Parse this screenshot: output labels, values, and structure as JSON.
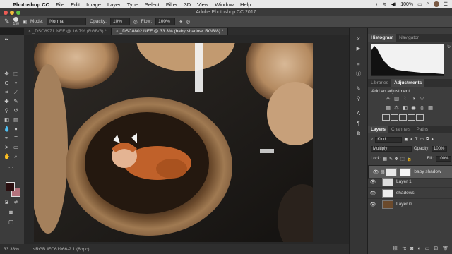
{
  "menubar": {
    "apple": "",
    "app": "Photoshop CC",
    "items": [
      "File",
      "Edit",
      "Image",
      "Layer",
      "Type",
      "Select",
      "Filter",
      "3D",
      "View",
      "Window",
      "Help"
    ],
    "battery": "100%",
    "clock": ""
  },
  "window": {
    "title": "Adobe Photoshop CC 2017"
  },
  "options": {
    "brush_size": "150",
    "mode_label": "Mode:",
    "mode_value": "Normal",
    "opacity_label": "Opacity:",
    "opacity_value": "10%",
    "flow_label": "Flow:",
    "flow_value": "100%"
  },
  "tabs": [
    {
      "label": "_DSC8971.NEF @ 16.7% (RGB/8) *"
    },
    {
      "label": "_DSC8802.NEF @ 33.3% (baby shadow, RGB/8) *"
    }
  ],
  "status": {
    "zoom": "33.33%",
    "profile": "sRGB IEC61966-2.1 (8bpc)"
  },
  "panels": {
    "histogram_tabs": [
      "Histogram",
      "Navigator"
    ],
    "adjust_tabs": [
      "Libraries",
      "Adjustments"
    ],
    "add_adjustment": "Add an adjustment",
    "layers_tabs": [
      "Layers",
      "Channels",
      "Paths"
    ],
    "kind": "Kind",
    "blend_mode": "Multiply",
    "opacity_label": "Opacity:",
    "opacity_value": "100%",
    "lock_label": "Lock:",
    "fill_label": "Fill:",
    "fill_value": "100%",
    "layers": [
      {
        "name": "baby shadow"
      },
      {
        "name": "Layer 1"
      },
      {
        "name": "shadows"
      },
      {
        "name": "Layer 0"
      }
    ]
  },
  "colors": {
    "foreground": "#2a0f10",
    "background": "#b5737d",
    "accent": "#4a86c8"
  }
}
